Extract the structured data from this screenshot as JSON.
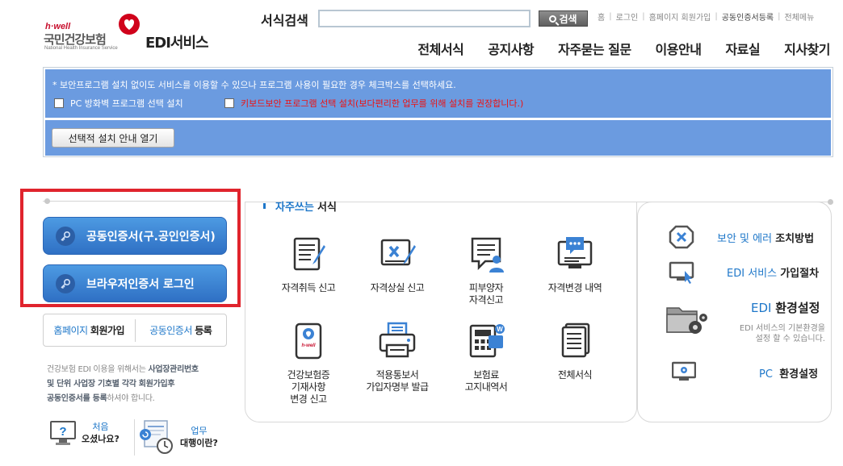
{
  "header": {
    "brand_small": "h·well",
    "brand_name": "국민건강보험",
    "brand_en": "National Health Insurance Service",
    "service_title": "EDI서비스",
    "search_label": "서식검색",
    "search_value": "",
    "search_button": "검색",
    "util_links": [
      "홈",
      "로그인",
      "홈페이지 회원가입",
      "공동인증서등록",
      "전체메뉴"
    ],
    "gnb": [
      "전체서식",
      "공지사항",
      "자주묻는 질문",
      "이용안내",
      "자료실",
      "지사찾기"
    ]
  },
  "notice": {
    "message": "* 보안프로그램 설치 없이도 서비스를 이용할 수 있으나 프로그램 사용이 필요한 경우 체크박스를 선택하세요.",
    "option1": "PC 방화벽 프로그램 선택 설치",
    "option2": "키보드보안 프로그램 선택 설치(보다편리한 업무를 위해 설치를 권장합니다.)",
    "guide_button": "선택적 설치 안내 열기"
  },
  "login": {
    "cert_button": "공동인증서(구.공인인증서)",
    "browser_button": "브라우저인증서 로그인",
    "join_blue": "홈페이지",
    "join_dark": "회원가입",
    "cert_reg_blue": "공동인증서",
    "cert_reg_dark": "등록",
    "desc_1": "건강보험 EDI 이용을 위해서는 ",
    "desc_b1": "사업장관리번호",
    "desc_b2": "및 단위 사업장 기호별 각각 회원가입후",
    "desc_b3": "공동인증서를 등록",
    "desc_2": "하셔야 합니다.",
    "help1_line1": "처음",
    "help1_line2": "오셨나요?",
    "help2_line1": "업무",
    "help2_line2": "대행이란?"
  },
  "forms": {
    "title_blue": "자주쓰는",
    "title_dark": "서식",
    "items": [
      {
        "label": "자격취득 신고",
        "icon": "document-pen-icon"
      },
      {
        "label": "자격상실 신고",
        "icon": "document-cancel-icon"
      },
      {
        "label": "피부양자\n자격신고",
        "icon": "dependent-person-icon"
      },
      {
        "label": "자격변경 내역",
        "icon": "monitor-chat-icon"
      },
      {
        "label": "건강보험증\n기재사항\n변경 신고",
        "icon": "insurance-card-icon"
      },
      {
        "label": "적용통보서\n가입자명부 발급",
        "icon": "printer-icon"
      },
      {
        "label": "보험료\n고지내역서",
        "icon": "calculator-icon"
      },
      {
        "label": "전체서식",
        "icon": "document-stack-icon"
      }
    ]
  },
  "right": {
    "security_blue": "보안 및 에러",
    "security_dark": "조치방법",
    "join_blue": "EDI 서비스",
    "join_dark": "가입절차",
    "env_blue": "EDI",
    "env_dark": "환경설정",
    "env_desc": "EDI 서비스의 기본환경을\n설정 할 수 있습니다.",
    "pc_blue": "PC",
    "pc_dark": "환경설정"
  },
  "colors": {
    "brand_red": "#c8102e",
    "notice_blue": "#6b9be0",
    "button_blue": "#3b82d4",
    "link_blue": "#1e77c9",
    "highlight_red": "#e0242d"
  }
}
